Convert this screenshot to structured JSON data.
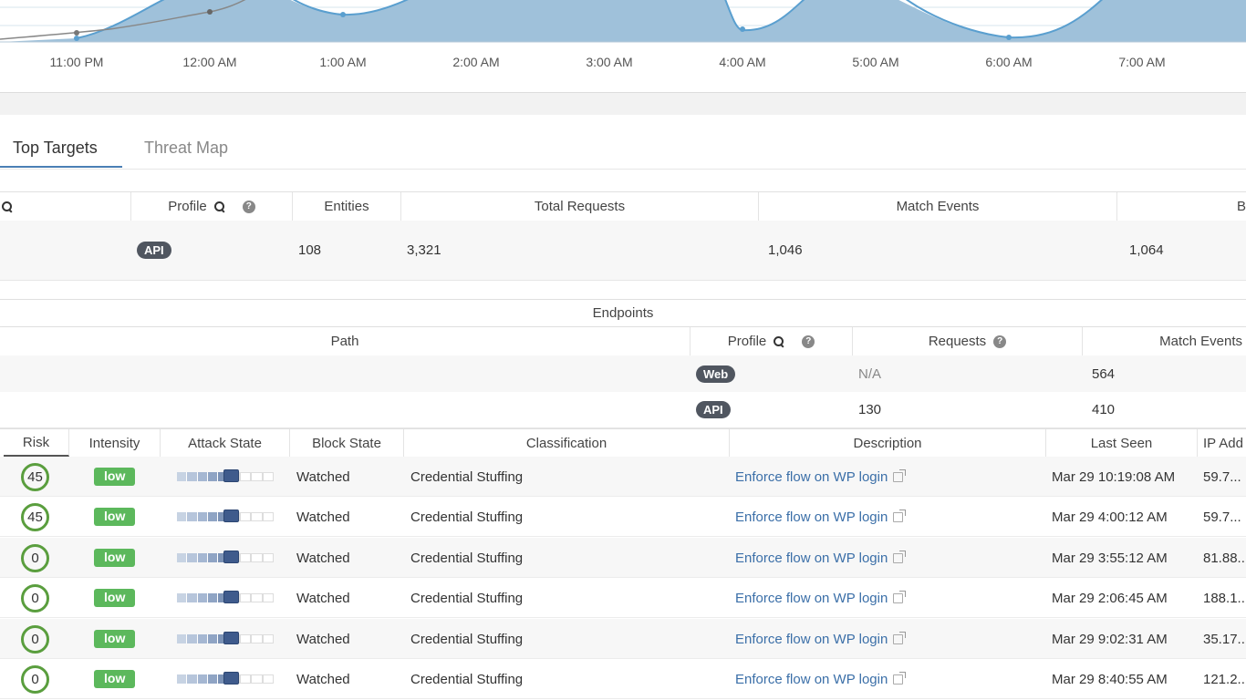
{
  "chart": {
    "x_ticks": [
      "11:00 PM",
      "12:00 AM",
      "1:00 AM",
      "2:00 AM",
      "3:00 AM",
      "4:00 AM",
      "5:00 AM",
      "6:00 AM",
      "7:00 AM"
    ],
    "fill_color": "#9fc1da",
    "line_color": "#5a9fcf"
  },
  "tabs": [
    {
      "label": "Top Targets",
      "active": true
    },
    {
      "label": "Threat Map",
      "active": false
    }
  ],
  "targets": {
    "headers": {
      "profile": "Profile",
      "entities": "Entities",
      "total_requests": "Total Requests",
      "match_events": "Match Events",
      "blocked": "B"
    },
    "row": {
      "profile": "API",
      "entities": "108",
      "total_requests": "3,321",
      "match_events": "1,046",
      "blocked": "1,064"
    }
  },
  "endpoints": {
    "title": "Endpoints",
    "headers": {
      "path": "Path",
      "profile": "Profile",
      "requests": "Requests",
      "match_events": "Match Events"
    },
    "rows": [
      {
        "profile": "Web",
        "requests": "N/A",
        "match_events": "564"
      },
      {
        "profile": "API",
        "requests": "130",
        "match_events": "410"
      }
    ]
  },
  "events": {
    "headers": {
      "risk": "Risk",
      "intensity": "Intensity",
      "attack_state": "Attack State",
      "block_state": "Block State",
      "classification": "Classification",
      "description": "Description",
      "last_seen": "Last Seen",
      "ip": "IP Add"
    },
    "rows": [
      {
        "risk": "45",
        "intensity": "low",
        "block_state": "Watched",
        "classification": "Credential Stuffing",
        "description": "Enforce flow on WP login",
        "last_seen": "Mar 29 10:19:08 AM",
        "ip": "59.7..."
      },
      {
        "risk": "45",
        "intensity": "low",
        "block_state": "Watched",
        "classification": "Credential Stuffing",
        "description": "Enforce flow on WP login",
        "last_seen": "Mar 29 4:00:12 AM",
        "ip": "59.7..."
      },
      {
        "risk": "0",
        "intensity": "low",
        "block_state": "Watched",
        "classification": "Credential Stuffing",
        "description": "Enforce flow on WP login",
        "last_seen": "Mar 29 3:55:12 AM",
        "ip": "81.88..."
      },
      {
        "risk": "0",
        "intensity": "low",
        "block_state": "Watched",
        "classification": "Credential Stuffing",
        "description": "Enforce flow on WP login",
        "last_seen": "Mar 29 2:06:45 AM",
        "ip": "188.1..."
      },
      {
        "risk": "0",
        "intensity": "low",
        "block_state": "Watched",
        "classification": "Credential Stuffing",
        "description": "Enforce flow on WP login",
        "last_seen": "Mar 29 9:02:31 AM",
        "ip": "35.17..."
      },
      {
        "risk": "0",
        "intensity": "low",
        "block_state": "Watched",
        "classification": "Credential Stuffing",
        "description": "Enforce flow on WP login",
        "last_seen": "Mar 29 8:40:55 AM",
        "ip": "121.2..."
      }
    ]
  }
}
